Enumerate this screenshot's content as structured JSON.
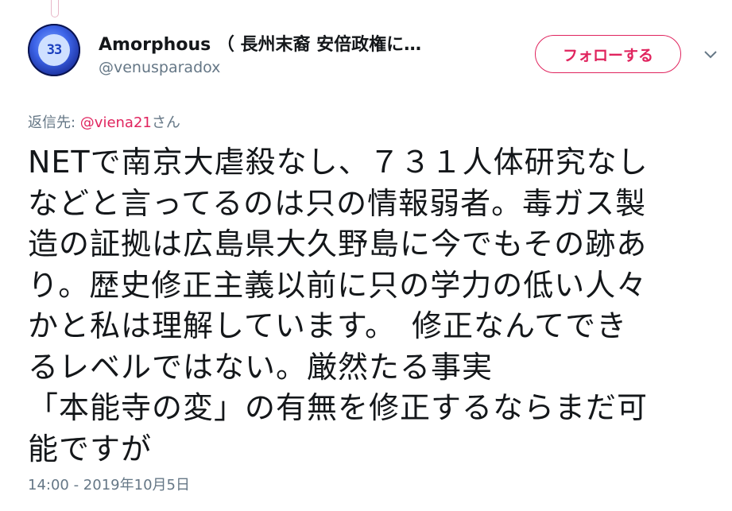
{
  "author": {
    "display_name": "Amorphous （ 長州末裔 安倍政権に…",
    "handle": "@venusparadox",
    "avatar_text": "33"
  },
  "follow_button": {
    "label": "フォローする"
  },
  "reply": {
    "prefix": "返信先: ",
    "mention": "@viena21",
    "suffix": "さん"
  },
  "tweet": {
    "lines": [
      {
        "before": "NETで南京大虐殺なし、７３１人体研究なし",
        "highlight": "",
        "after": ""
      },
      {
        "before": "などと言ってるのは",
        "highlight": "只の情報弱者",
        "after": "。毒ガス製"
      },
      {
        "before": "造の証拠は広島県大久野島に今でもその跡あ",
        "highlight": "",
        "after": ""
      },
      {
        "before": "り。",
        "highlight": "歴史修正主義以前に只の学力の低い人々",
        "after": ""
      },
      {
        "before": "かと私は理解しています。　修正なんてでき",
        "highlight": "",
        "after": ""
      },
      {
        "before": "るレベルではない。厳然たる事実",
        "highlight": "",
        "after": ""
      },
      {
        "before": "「本能寺の変」の有無を修正するならまだ可",
        "highlight": "",
        "after": ""
      },
      {
        "before": "能ですが",
        "highlight": "",
        "after": ""
      }
    ],
    "highlight_color": "#f2c200"
  },
  "timestamp": "14:00 - 2019年10月5日",
  "colors": {
    "accent": "#e0245e",
    "secondary_text": "#657786",
    "primary_text": "#14171a"
  }
}
